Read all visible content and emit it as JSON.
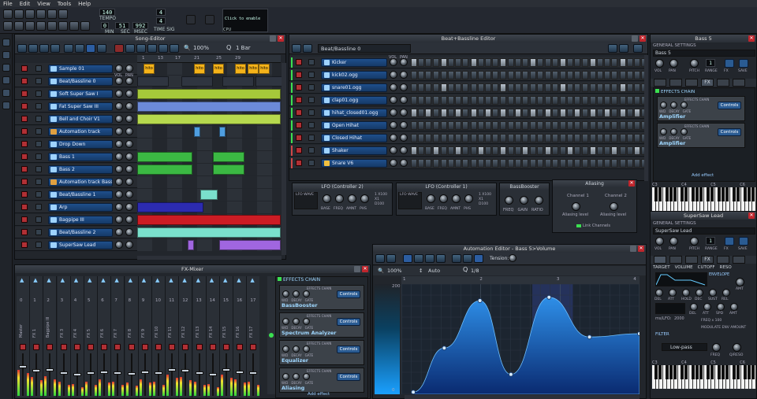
{
  "menu": [
    "File",
    "Edit",
    "View",
    "Tools",
    "Help"
  ],
  "toolbar": {
    "tempo": "140",
    "tempo_label": "TEMPO",
    "min": "0",
    "sec": "51",
    "msec": "992",
    "min_label": "MIN",
    "sec_label": "SEC",
    "msec_label": "MSEC",
    "timesig_top": "4",
    "timesig_bottom": "4",
    "timesig_label": "TIME SIG",
    "cpu_hint": "Click to enable",
    "cpu_label": "CPU"
  },
  "song_editor": {
    "title": "Song-Editor",
    "zoom": "100%",
    "quant": "1 Bar",
    "bars": [
      "1",
      "13",
      "17",
      "21",
      "25",
      "29"
    ],
    "tracks": [
      {
        "name": "Sample 01"
      },
      {
        "name": "Beat/Bassline 0"
      },
      {
        "name": "Soft Super Saw I"
      },
      {
        "name": "Fat Super Saw III"
      },
      {
        "name": "Bell and Choir V1"
      },
      {
        "name": "Automation track"
      },
      {
        "name": "Drop Down"
      },
      {
        "name": "Bass 1"
      },
      {
        "name": "Bass 2"
      },
      {
        "name": "Automation track Bass 1"
      },
      {
        "name": "Beat/Bassline 1"
      },
      {
        "name": "Arp"
      },
      {
        "name": "Bagpipe III"
      },
      {
        "name": "Beat/Bassline 2"
      },
      {
        "name": "SuperSaw Lead"
      }
    ],
    "vol_label": "VOL",
    "pan_label": "PAN",
    "clip_text": "hito"
  },
  "bb_editor": {
    "title": "Beat+Bassline Editor",
    "pattern": "Beat/Bassline 0",
    "tracks": [
      "Kicker",
      "kick02.ogg",
      "snare01.ogg",
      "clap01.ogg",
      "hihat_closed01.ogg",
      "Open Hihat",
      "Closed Hihat",
      "Shaker",
      "Snare V6"
    ]
  },
  "controllers": {
    "lfo2": "LFO (Controller 2)",
    "lfo1": "LFO (Controller 1)",
    "knob_labels": [
      "BASE",
      "FREQ",
      "AMNT",
      "PHS"
    ],
    "wave_label": "LFO WAVE",
    "multiplier": [
      "1 X100",
      "X1",
      "D100"
    ],
    "bassbooster": "BassBooster",
    "bb_knobs": [
      "FREQ",
      "GAIN",
      "RATIO"
    ],
    "aliasing": "Aliasing",
    "ch1": "Channel 1",
    "ch2": "Channel 2",
    "alias_level": "Aliasing level",
    "link": "Link Channels"
  },
  "fx_mixer": {
    "title": "FX-Mixer",
    "channels": [
      "Master",
      "FX 1",
      "Bagpipe III",
      "FX 3",
      "FX 4",
      "FX 5",
      "FX 6",
      "FX 7",
      "FX 8",
      "FX 9",
      "FX 10",
      "FX 11",
      "FX 12",
      "FX 13",
      "FX 14",
      "FX 15",
      "FX 16",
      "FX 17"
    ],
    "numbers": [
      "0",
      "1",
      "2",
      "3",
      "4",
      "5",
      "6",
      "7",
      "8",
      "9",
      "10",
      "11",
      "12",
      "13",
      "14",
      "15",
      "16",
      "17"
    ],
    "effects_chain": "EFFECTS CHAIN",
    "effects": [
      "BassBooster",
      "Spectrum Analyzer",
      "Equalizer",
      "Aliasing"
    ],
    "effects_chain_small": "EFFECTS CHAIN",
    "fx_knobs": [
      "W/D",
      "DECAY",
      "GATE"
    ],
    "controls": "Controls",
    "add_effect": "Add effect"
  },
  "automation": {
    "title": "Automation Editor - Bass 5>Volume",
    "tension": "Tension:",
    "zoom": "100%",
    "mode": "Auto",
    "quant": "1/8",
    "ruler": [
      "1",
      "2",
      "3",
      "4"
    ],
    "top_value": "200",
    "bottom_value": "0",
    "points": [
      [
        0.05,
        0.02
      ],
      [
        0.18,
        0.42
      ],
      [
        0.33,
        0.85
      ],
      [
        0.46,
        0.18
      ],
      [
        0.62,
        0.88
      ],
      [
        0.79,
        0.52
      ],
      [
        1.0,
        0.55
      ]
    ]
  },
  "bass5": {
    "title": "Bass 5",
    "general": "GENERAL SETTINGS",
    "name": "Bass 5",
    "knobs": [
      "VOL",
      "PAN",
      "PITCH",
      "RANGE",
      "FX",
      "SAVE"
    ],
    "range_value": "1",
    "fx_tab": "FX",
    "effects_chain": "EFFECTS CHAIN",
    "effects_chain_small": "EFFECTS CHAIN",
    "effect": "Amplifier",
    "fx_knobs": [
      "W/D",
      "DECAY",
      "GATE"
    ],
    "controls": "Controls",
    "add_effect": "Add effect",
    "keys": [
      "C3",
      "C4",
      "C5",
      "C6"
    ]
  },
  "supersaw": {
    "title": "SuperSaw Lead",
    "general": "GENERAL SETTINGS",
    "name": "SuperSaw Lead",
    "knobs": [
      "VOL",
      "PAN",
      "PITCH",
      "RANGE",
      "FX",
      "SAVE"
    ],
    "range_value": "1",
    "fx_tab": "FX",
    "tabs": [
      "TARGET",
      "VOLUME",
      "CUTOFF",
      "RESO"
    ],
    "envelope": "ENVELOPE",
    "amt": "AMT",
    "env_knobs": [
      "DEL",
      "ATT",
      "HOLD",
      "DEC",
      "SUST",
      "REL"
    ],
    "lfo_knobs": [
      "DEL",
      "ATT",
      "SPD",
      "AMT"
    ],
    "ms_lfo": "ms/LFO:",
    "ms_value": "2000",
    "freq_x": "FREQ x 100",
    "modulate": "MODULATE ENV AMOUNT",
    "filter": "FILTER",
    "filter_type": "Low-pass",
    "freq": "FREQ",
    "q": "Q/RESO",
    "keys": [
      "C3",
      "C4",
      "C5",
      "C6"
    ]
  },
  "colors": {
    "accent": "#1f4f8c",
    "close": "#c0262d",
    "grid_blue": "#2e66b8"
  }
}
